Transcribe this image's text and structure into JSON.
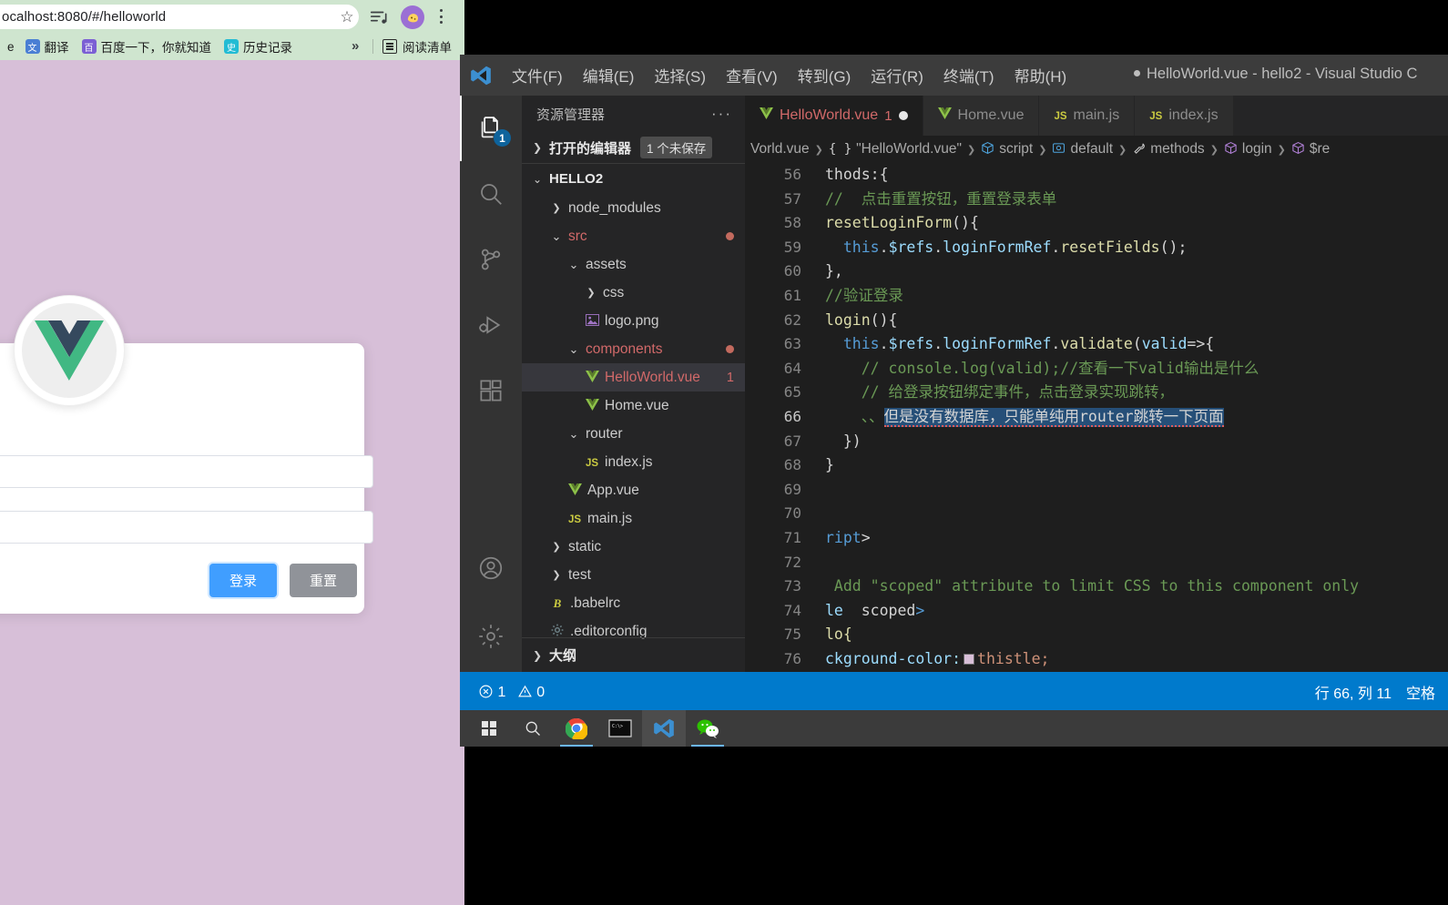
{
  "browser": {
    "url": "ocalhost:8080/#/helloworld",
    "star_icon": "star-icon",
    "menu_icon": "more-vertical-icon",
    "bookmarks": [
      {
        "label": "翻译",
        "icon_bg": "#4a7fd4",
        "glyph": "文"
      },
      {
        "label": "百度一下，你就知道",
        "icon_bg": "#7b5fd4",
        "glyph": "百"
      },
      {
        "label": "历史记录",
        "icon_bg": "#22bcd4",
        "glyph": "历"
      }
    ],
    "overflow_label": "»",
    "reading_list_label": "阅读清单"
  },
  "app": {
    "login_button": "登录",
    "reset_button": "重置",
    "username_value": "",
    "password_value": "",
    "username_placeholder": "",
    "password_placeholder": "",
    "background_color": "#d8bfd8",
    "primary_color": "#409eff"
  },
  "vscode": {
    "title": "HelloWorld.vue - hello2 - Visual Studio C",
    "menus": [
      "文件(F)",
      "编辑(E)",
      "选择(S)",
      "查看(V)",
      "转到(G)",
      "运行(R)",
      "终端(T)",
      "帮助(H)"
    ],
    "activity_bar": [
      {
        "name": "explorer-icon",
        "badge": "1",
        "active": true
      },
      {
        "name": "search-icon",
        "badge": "",
        "active": false
      },
      {
        "name": "source-control-icon",
        "badge": "",
        "active": false
      },
      {
        "name": "run-debug-icon",
        "badge": "",
        "active": false
      },
      {
        "name": "extensions-icon",
        "badge": "",
        "active": false
      },
      {
        "name": "accounts-icon",
        "badge": "",
        "active": false
      },
      {
        "name": "settings-gear-icon",
        "badge": "",
        "active": false
      }
    ],
    "sidebar": {
      "title": "资源管理器",
      "open_editors_label": "打开的编辑器",
      "unsaved_badge": "1 个未保存",
      "project_name": "HELLO2",
      "outline_label": "大纲",
      "tree": [
        {
          "label": "node_modules",
          "indent": 1,
          "icon": "chevron-right-icon",
          "kind": "folder",
          "color": "#cccccc",
          "dot": false,
          "count": ""
        },
        {
          "label": "src",
          "indent": 1,
          "icon": "chevron-down-icon",
          "kind": "folder",
          "color": "#d16969",
          "dot": true,
          "count": ""
        },
        {
          "label": "assets",
          "indent": 2,
          "icon": "chevron-down-icon",
          "kind": "folder",
          "color": "#cccccc",
          "dot": false,
          "count": ""
        },
        {
          "label": "css",
          "indent": 3,
          "icon": "chevron-right-icon",
          "kind": "folder",
          "color": "#cccccc",
          "dot": false,
          "count": ""
        },
        {
          "label": "logo.png",
          "indent": 3,
          "icon": "image-file-icon",
          "kind": "file",
          "color": "#cccccc",
          "dot": false,
          "count": ""
        },
        {
          "label": "components",
          "indent": 2,
          "icon": "chevron-down-icon",
          "kind": "folder",
          "color": "#d16969",
          "dot": true,
          "count": ""
        },
        {
          "label": "HelloWorld.vue",
          "indent": 3,
          "icon": "vue-file-icon",
          "kind": "file",
          "color": "#d16969",
          "dot": false,
          "count": "1",
          "selected": true
        },
        {
          "label": "Home.vue",
          "indent": 3,
          "icon": "vue-file-icon",
          "kind": "file",
          "color": "#cccccc",
          "dot": false,
          "count": ""
        },
        {
          "label": "router",
          "indent": 2,
          "icon": "chevron-down-icon",
          "kind": "folder",
          "color": "#cccccc",
          "dot": false,
          "count": ""
        },
        {
          "label": "index.js",
          "indent": 3,
          "icon": "js-file-icon",
          "kind": "file",
          "color": "#cccccc",
          "dot": false,
          "count": ""
        },
        {
          "label": "App.vue",
          "indent": 2,
          "icon": "vue-file-icon",
          "kind": "file",
          "color": "#cccccc",
          "dot": false,
          "count": ""
        },
        {
          "label": "main.js",
          "indent": 2,
          "icon": "js-file-icon",
          "kind": "file",
          "color": "#cccccc",
          "dot": false,
          "count": ""
        },
        {
          "label": "static",
          "indent": 1,
          "icon": "chevron-right-icon",
          "kind": "folder",
          "color": "#cccccc",
          "dot": false,
          "count": ""
        },
        {
          "label": "test",
          "indent": 1,
          "icon": "chevron-right-icon",
          "kind": "folder",
          "color": "#cccccc",
          "dot": false,
          "count": ""
        },
        {
          "label": ".babelrc",
          "indent": 1,
          "icon": "babel-file-icon",
          "kind": "file",
          "color": "#cccccc",
          "dot": false,
          "count": ""
        },
        {
          "label": ".editorconfig",
          "indent": 1,
          "icon": "gear-file-icon",
          "kind": "file",
          "color": "#cccccc",
          "dot": false,
          "count": ""
        }
      ]
    },
    "tabs": [
      {
        "label": "HelloWorld.vue",
        "icon": "vue-file-icon",
        "errors": "1",
        "dirty": true,
        "active": true
      },
      {
        "label": "Home.vue",
        "icon": "vue-file-icon",
        "errors": "",
        "dirty": false,
        "active": false
      },
      {
        "label": "main.js",
        "icon": "js-file-icon",
        "errors": "",
        "dirty": false,
        "active": false
      },
      {
        "label": "index.js",
        "icon": "js-file-icon",
        "errors": "",
        "dirty": false,
        "active": false
      }
    ],
    "breadcrumb": [
      {
        "label": "Vorld.vue",
        "icon": ""
      },
      {
        "label": "\"HelloWorld.vue\"",
        "icon": "{ }"
      },
      {
        "label": "script",
        "icon": "cube-icon"
      },
      {
        "label": "default",
        "icon": "module-icon"
      },
      {
        "label": "methods",
        "icon": "wrench-icon"
      },
      {
        "label": "login",
        "icon": "cube-purple-icon"
      },
      {
        "label": "$re",
        "icon": "cube-purple-icon"
      }
    ],
    "code_lines": [
      {
        "n": "56",
        "segments": [
          {
            "t": "thods:{",
            "c": "pl"
          }
        ]
      },
      {
        "n": "57",
        "segments": [
          {
            "t": "//  点击重置按钮，重置登录表单",
            "c": "cmt"
          }
        ]
      },
      {
        "n": "58",
        "segments": [
          {
            "t": "resetLoginForm",
            "c": "fn"
          },
          {
            "t": "(){",
            "c": "pl"
          }
        ]
      },
      {
        "n": "59",
        "segments": [
          {
            "t": "  ",
            "c": "pl"
          },
          {
            "t": "this",
            "c": "kw"
          },
          {
            "t": ".",
            "c": "pl"
          },
          {
            "t": "$refs",
            "c": "var"
          },
          {
            "t": ".",
            "c": "pl"
          },
          {
            "t": "loginFormRef",
            "c": "var"
          },
          {
            "t": ".",
            "c": "pl"
          },
          {
            "t": "resetFields",
            "c": "fn"
          },
          {
            "t": "();",
            "c": "pl"
          }
        ]
      },
      {
        "n": "60",
        "segments": [
          {
            "t": "},",
            "c": "pl"
          }
        ]
      },
      {
        "n": "61",
        "segments": [
          {
            "t": "//验证登录",
            "c": "cmt"
          }
        ]
      },
      {
        "n": "62",
        "segments": [
          {
            "t": "login",
            "c": "fn"
          },
          {
            "t": "(){",
            "c": "pl"
          }
        ]
      },
      {
        "n": "63",
        "segments": [
          {
            "t": "  ",
            "c": "pl"
          },
          {
            "t": "this",
            "c": "kw"
          },
          {
            "t": ".",
            "c": "pl"
          },
          {
            "t": "$refs",
            "c": "var"
          },
          {
            "t": ".",
            "c": "pl"
          },
          {
            "t": "loginFormRef",
            "c": "var"
          },
          {
            "t": ".",
            "c": "pl"
          },
          {
            "t": "validate",
            "c": "fn"
          },
          {
            "t": "(",
            "c": "pl"
          },
          {
            "t": "valid",
            "c": "var"
          },
          {
            "t": "=>",
            "c": "pl"
          },
          {
            "t": "{",
            "c": "pl"
          }
        ]
      },
      {
        "n": "64",
        "segments": [
          {
            "t": "    // console.log(valid);//查看一下valid输出是什么",
            "c": "cmt"
          }
        ]
      },
      {
        "n": "65",
        "segments": [
          {
            "t": "    // 给登录按钮绑定事件，点击登录实现跳转，",
            "c": "cmt"
          }
        ]
      },
      {
        "n": "66",
        "current": true,
        "segments": [
          {
            "t": "    、、",
            "c": "cmt"
          },
          {
            "t": "但是没有数据库，只能单纯用router跳转一下页面",
            "c": "sel"
          }
        ]
      },
      {
        "n": "67",
        "segments": [
          {
            "t": "  })",
            "c": "pl"
          }
        ]
      },
      {
        "n": "68",
        "segments": [
          {
            "t": "}",
            "c": "pl"
          }
        ]
      },
      {
        "n": "69",
        "segments": []
      },
      {
        "n": "70",
        "segments": []
      },
      {
        "n": "71",
        "segments": [
          {
            "t": "ript",
            "c": "kw"
          },
          {
            "t": ">",
            "c": "pl"
          }
        ]
      },
      {
        "n": "72",
        "segments": []
      },
      {
        "n": "73",
        "segments": [
          {
            "t": " Add \"scoped\" attribute to limit CSS to this component only",
            "c": "cmt"
          }
        ]
      },
      {
        "n": "74",
        "segments": [
          {
            "t": "le",
            "c": "var"
          },
          {
            "t": "  ",
            "c": "pl"
          },
          {
            "t": "scoped",
            "c": "pl"
          },
          {
            "t": ">",
            "c": "kw"
          }
        ]
      },
      {
        "n": "75",
        "segments": [
          {
            "t": "lo{",
            "c": "fn"
          }
        ]
      },
      {
        "n": "76",
        "segments": [
          {
            "t": "ckground-color:",
            "c": "prop"
          },
          {
            "t": "__SWATCH__",
            "c": "swatch"
          },
          {
            "t": "thistle;",
            "c": "str"
          }
        ]
      }
    ],
    "statusbar": {
      "errors": "1",
      "warnings": "0",
      "error_icon": "error-circle-icon",
      "warning_icon": "warning-triangle-icon",
      "position": "行 66, 列 11",
      "indent": "空格"
    }
  },
  "taskbar": {
    "items": [
      {
        "name": "start-button",
        "glyph": "windows-icon"
      },
      {
        "name": "search-taskbar-icon",
        "glyph": "search-icon"
      },
      {
        "name": "chrome-taskbar-icon",
        "glyph": "chrome-icon",
        "running": true
      },
      {
        "name": "terminal-taskbar-icon",
        "glyph": "terminal-icon"
      },
      {
        "name": "vscode-taskbar-icon",
        "glyph": "vscode-icon",
        "active": true
      },
      {
        "name": "wechat-taskbar-icon",
        "glyph": "wechat-icon",
        "running": true
      }
    ]
  }
}
